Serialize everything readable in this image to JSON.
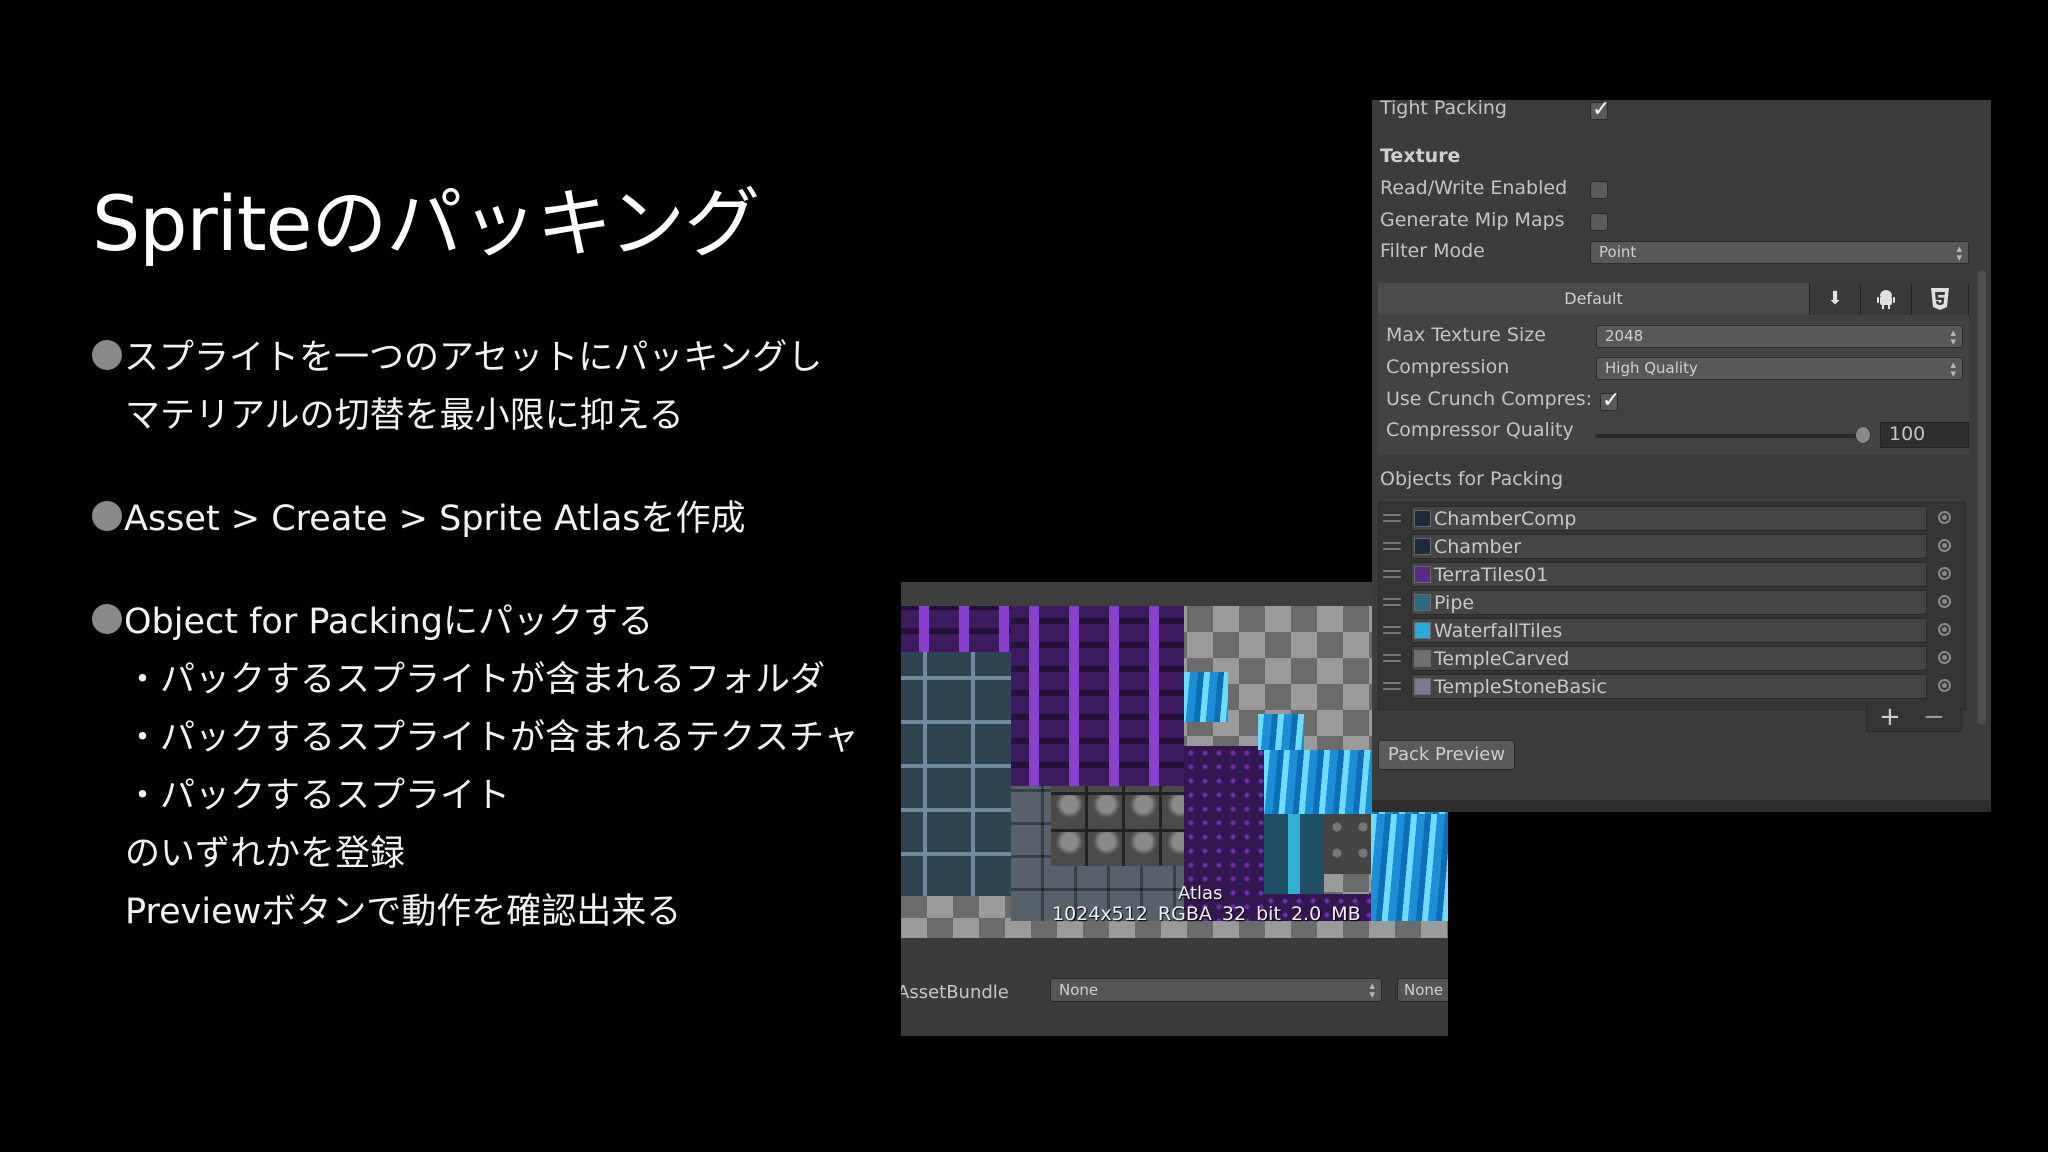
{
  "slide": {
    "title": "Spriteのパッキング",
    "bullets": {
      "b1_line1": "スプライトを一つのアセットにパッキングし",
      "b1_line2": "マテリアルの切替を最小限に抑える",
      "b2": "Asset > Create > Sprite Atlasを作成",
      "b3": "Object for Packingにパックする",
      "sub1": "・パックするスプライトが含まれるフォルダ",
      "sub2": "・パックするスプライトが含まれるテクスチャ",
      "sub3": "・パックするスプライト",
      "note1": "のいずれかを登録",
      "note2": "Previewボタンで動作を確認出来る"
    }
  },
  "atlas_preview": {
    "label": "Atlas",
    "info": "1024x512 RGBA 32 bit   2.0 MB",
    "assetbundle_label": "AssetBundle",
    "assetbundle_value": "None",
    "assetbundle_variant": "None"
  },
  "inspector": {
    "tight_packing_label": "Tight Packing",
    "tight_packing_checked": true,
    "texture_header": "Texture",
    "read_write_label": "Read/Write Enabled",
    "read_write_checked": false,
    "mipmaps_label": "Generate Mip Maps",
    "mipmaps_checked": false,
    "filter_mode_label": "Filter Mode",
    "filter_mode_value": "Point",
    "platform_default_tab": "Default",
    "platform_icons": [
      "download-icon",
      "android-icon",
      "html5-icon"
    ],
    "max_texture_size_label": "Max Texture Size",
    "max_texture_size_value": "2048",
    "compression_label": "Compression",
    "compression_value": "High Quality",
    "use_crunch_label": "Use Crunch Compres:",
    "use_crunch_checked": true,
    "compressor_quality_label": "Compressor Quality",
    "compressor_quality_value": "100",
    "compressor_quality_level": 1.0,
    "objects_header": "Objects for Packing",
    "objects": [
      {
        "name": "ChamberComp"
      },
      {
        "name": "Chamber"
      },
      {
        "name": "TerraTiles01"
      },
      {
        "name": "Pipe"
      },
      {
        "name": "WaterfallTiles"
      },
      {
        "name": "TempleCarved"
      },
      {
        "name": "TempleStoneBasic"
      }
    ],
    "add_button": "+",
    "remove_button": "−",
    "pack_preview_button": "Pack Preview"
  },
  "colors": {
    "background": "#000000",
    "bullet": "#8a8a8a",
    "panel": "#3c3c3c"
  }
}
